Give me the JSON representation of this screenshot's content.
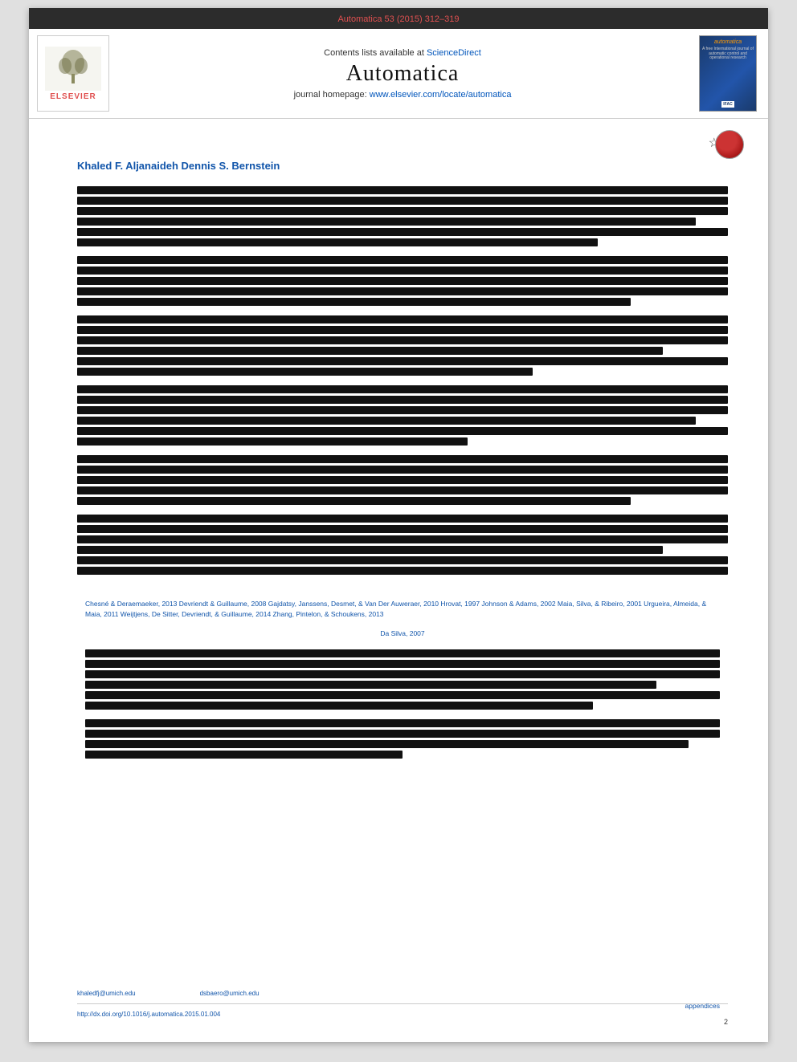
{
  "topbar": {
    "citation": "Automatica 53 (2015) 312–319"
  },
  "header": {
    "contents_label": "Contents lists available at",
    "sciencedirect": "ScienceDirect",
    "journal_title": "Automatica",
    "homepage_label": "journal homepage:",
    "homepage_url": "www.elsevier.com/locate/automatica",
    "elsevier_text": "ELSEVIER",
    "cover_title": "automatica",
    "cover_subtitle": "A free International journal of automatic control and operational research"
  },
  "article": {
    "authors": "Khaled F. Aljanaideh   Dennis S. Bernstein",
    "star_icon": "☆",
    "references": {
      "inline": "Chesné & Deraemaeker, 2013  Devriendt & Guillaume, 2008  Gajdatsy, Janssens, Desmet, & Van Der Auweraer, 2010  Hrovat, 1997  Johnson & Adams, 2002  Maia, Silva, & Ribeiro, 2001  Urgueira, Almeida, & Maia, 2011  Weijtjens, De Sitter, Devriendt, & Guillaume, 2014  Zhang, Pintelon, & Schoukens, 2013",
      "da_silva": "Da Silva, 2007"
    },
    "footer": {
      "email1": "khaledfj@umich.edu",
      "email2": "dsbaero@umich.edu",
      "appendices": "appendices",
      "page": "2",
      "doi": "http://dx.doi.org/10.1016/j.automatica.2015.01.004"
    }
  }
}
